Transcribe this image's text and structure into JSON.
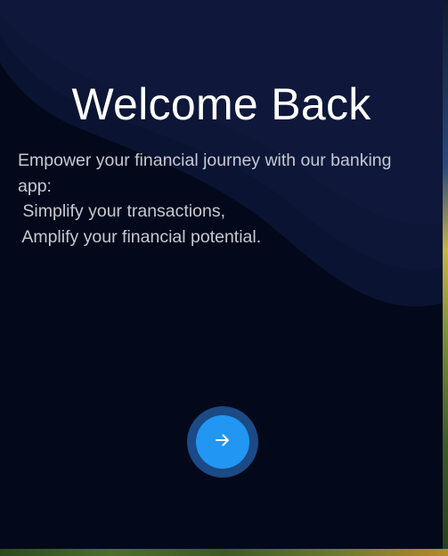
{
  "welcome": {
    "title": "Welcome Back",
    "description_lines": [
      "Empower your financial journey with our banking",
      "app:",
      " Simplify your transactions,",
      " Amplify your financial potential."
    ]
  },
  "next_button": {
    "icon": "arrow-right-icon",
    "accent_color": "#2196f3"
  },
  "colors": {
    "card_background": "#03091a",
    "title_text": "#ffffff",
    "body_text": "#c5c9d3"
  }
}
